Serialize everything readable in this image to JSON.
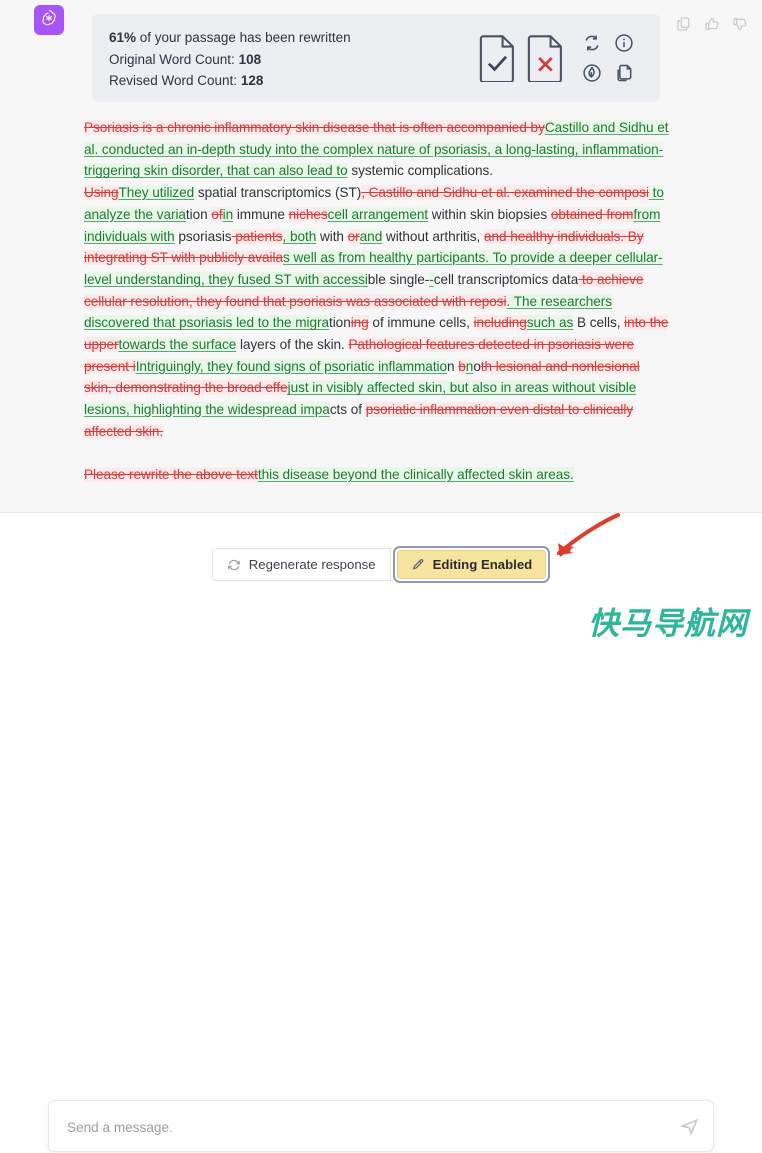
{
  "colors": {
    "accent_purple": "#a855f7",
    "insert_text": "#1c7b30",
    "insert_bg": "#e9f7e9",
    "delete_text": "#d63a3a",
    "delete_bg": "#fdeaea",
    "editing_button_bg": "#f8e49f",
    "focus_ring": "#9498ad",
    "panel_bg": "#f7f7f8",
    "card_bg": "#eceef2",
    "watermark": "#2fb59a",
    "annotation_arrow": "#e03b2f"
  },
  "avatar": {
    "icon": "openai-logo-icon"
  },
  "message_actions": [
    {
      "name": "copy-icon",
      "label": "Copy"
    },
    {
      "name": "thumbs-up-icon",
      "label": "Good response"
    },
    {
      "name": "thumbs-down-icon",
      "label": "Bad response"
    }
  ],
  "summary_card": {
    "rewritten_percent": "61%",
    "rewritten_suffix": " of your passage has been rewritten",
    "original_label": "Original Word Count:",
    "original_value": "108",
    "revised_label": "Revised Word Count:",
    "revised_value": "128",
    "icons": [
      {
        "name": "accept-all-document-icon",
        "label": "Accept all changes"
      },
      {
        "name": "reject-all-document-icon",
        "label": "Reject all changes"
      },
      {
        "name": "refresh-loop-icon",
        "label": "Regenerate"
      },
      {
        "name": "info-icon",
        "label": "Info"
      },
      {
        "name": "feather-circle-icon",
        "label": "Humanize"
      },
      {
        "name": "copy-document-icon",
        "label": "Copy text"
      }
    ]
  },
  "diff": {
    "paragraphs": [
      {
        "segments": [
          {
            "type": "del",
            "text": "Psoriasis is a chronic inflammatory skin disease that is often accompanied by"
          },
          {
            "type": "ins",
            "text": "Castillo and Sidhu et al. conducted an in-depth study into the complex nature of psoriasis, a long-lasting, inflammation-triggering skin disorder, that can also lead to"
          },
          {
            "type": "eq",
            "text": " systemic complications."
          }
        ]
      },
      {
        "segments": [
          {
            "type": "del",
            "text": "Using"
          },
          {
            "type": "ins",
            "text": "They utilized"
          },
          {
            "type": "eq",
            "text": " spatial transcriptomics (ST)"
          },
          {
            "type": "del",
            "text": ", Castillo and Sidhu et al. examined the composi"
          },
          {
            "type": "ins",
            "text": " to analyze the varia"
          },
          {
            "type": "eq",
            "text": "tion "
          },
          {
            "type": "del",
            "text": "of"
          },
          {
            "type": "ins",
            "text": "in"
          },
          {
            "type": "eq",
            "text": " immune "
          },
          {
            "type": "del",
            "text": "niches"
          },
          {
            "type": "ins",
            "text": "cell arrangement"
          },
          {
            "type": "eq",
            "text": " within skin biopsies "
          },
          {
            "type": "del",
            "text": "obtained from"
          },
          {
            "type": "ins",
            "text": "from individuals with"
          },
          {
            "type": "eq",
            "text": " psoriasis"
          },
          {
            "type": "del",
            "text": " patients"
          },
          {
            "type": "ins",
            "text": ", both"
          },
          {
            "type": "eq",
            "text": " with "
          },
          {
            "type": "del",
            "text": "or"
          },
          {
            "type": "ins",
            "text": "and"
          },
          {
            "type": "eq",
            "text": " without arthritis, "
          },
          {
            "type": "del",
            "text": "and healthy individuals. By integrating ST with publicly availa"
          },
          {
            "type": "ins",
            "text": "s well as from healthy participants. To provide a deeper cellular-level understanding, they fused ST with accessi"
          },
          {
            "type": "eq",
            "text": "ble single-"
          },
          {
            "type": "ins",
            "text": "-"
          },
          {
            "type": "eq",
            "text": "cell transcriptomics data"
          },
          {
            "type": "del",
            "text": " to achieve cellular resolution, they found that psoriasis was associated with reposi"
          },
          {
            "type": "ins",
            "text": ". The researchers discovered that psoriasis led to the migra"
          },
          {
            "type": "eq",
            "text": "tion"
          },
          {
            "type": "del",
            "text": "ing"
          },
          {
            "type": "eq",
            "text": " of immune cells, "
          },
          {
            "type": "del",
            "text": "including"
          },
          {
            "type": "ins",
            "text": "such as"
          },
          {
            "type": "eq",
            "text": " B cells, "
          },
          {
            "type": "del",
            "text": "into the upper"
          },
          {
            "type": "ins",
            "text": "towards the surface"
          },
          {
            "type": "eq",
            "text": " layers of the skin. "
          },
          {
            "type": "del",
            "text": "Pathological features detected in psoriasis were present i"
          },
          {
            "type": "ins",
            "text": "Intriguingly, they found signs of psoriatic inflammatio"
          },
          {
            "type": "eq",
            "text": "n "
          },
          {
            "type": "del",
            "text": "b"
          },
          {
            "type": "ins",
            "text": "n"
          },
          {
            "type": "eq",
            "text": "o"
          },
          {
            "type": "del",
            "text": "th lesional and nonlesional skin, demonstrating the broad effe"
          },
          {
            "type": "ins",
            "text": "just in visibly affected skin, but also in areas without visible lesions, highlighting the widespread impa"
          },
          {
            "type": "eq",
            "text": "cts of "
          },
          {
            "type": "del",
            "text": "psoriatic inflammation even distal to clinically affected skin."
          }
        ]
      },
      {
        "spacer": true
      },
      {
        "segments": [
          {
            "type": "del",
            "text": "Please rewrite the above text"
          },
          {
            "type": "ins",
            "text": "this disease beyond the clinically affected skin areas."
          }
        ]
      }
    ]
  },
  "footer": {
    "regenerate_label": "Regenerate response",
    "regenerate_icon": "refresh-icon",
    "editing_label": "Editing Enabled",
    "editing_icon": "pen-icon"
  },
  "composer": {
    "placeholder": "Send a message.",
    "value": "",
    "send_icon": "send-arrow-icon"
  },
  "watermark": {
    "text": "快马导航网"
  }
}
